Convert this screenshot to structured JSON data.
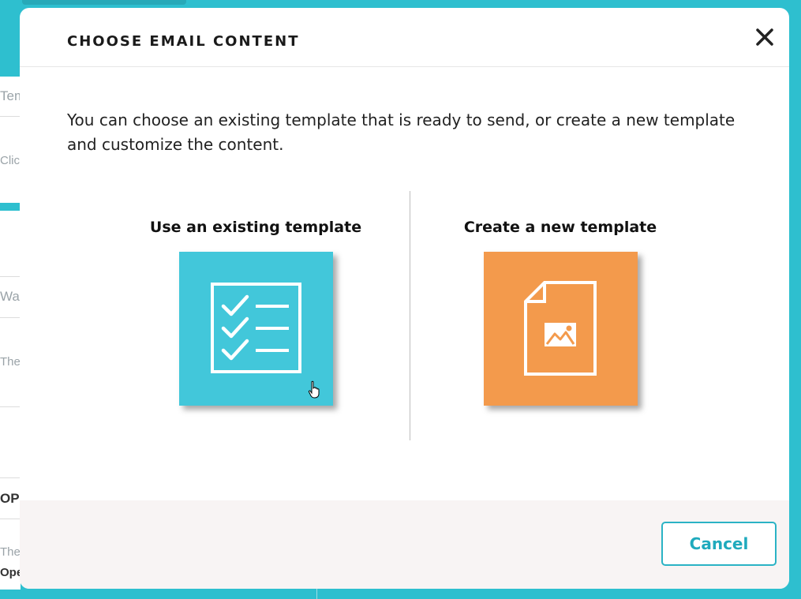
{
  "background": {
    "fragments": [
      "Tem",
      "Click",
      "Wa",
      "The",
      "OPI",
      "The",
      "Oper"
    ]
  },
  "modal": {
    "title": "CHOOSE EMAIL CONTENT",
    "close_icon": "close-icon",
    "intro": "You can choose an existing template that is ready to send, or create a new template and customize the content.",
    "options": [
      {
        "label": "Use an existing template",
        "icon": "checklist-icon",
        "color": "#42c7da"
      },
      {
        "label": "Create a new template",
        "icon": "new-document-image-icon",
        "color": "#f39a4c"
      }
    ],
    "footer": {
      "cancel_label": "Cancel"
    }
  },
  "colors": {
    "accent": "#2ebfcf",
    "cancel_border": "#2bb3c5",
    "footer_bg": "#f8f4f4"
  }
}
